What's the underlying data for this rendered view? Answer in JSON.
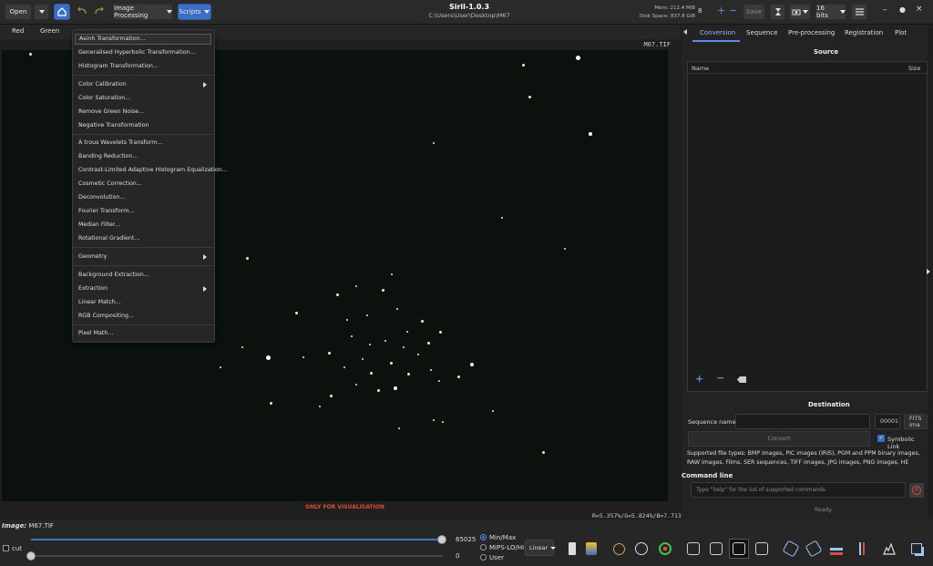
{
  "header": {
    "open_label": "Open",
    "image_processing_label": "Image Processing",
    "scripts_label": "Scripts",
    "app_title": "Siril-1.0.3",
    "file_path": "C:\\Users\\User\\Desktop\\M67",
    "mem": "Mem: 212.4 MiB",
    "disk": "Disk Space: 837.8 GiB",
    "thread_count": "8",
    "save_label": "Save",
    "bits_label": "16 bits"
  },
  "channel_tabs": [
    "Red",
    "Green"
  ],
  "image": {
    "filename": "M67.TIF",
    "only_vis": "ONLY FOR VISUALISATION",
    "rgb_readout": "R=5.357%/G=5.824%/B=7.713%"
  },
  "menu": {
    "items": [
      "Asinh Transformation...",
      "Generalised Hyperbolic Transformation...",
      "Histogram Transformation...",
      "Color Calibration",
      "Color Saturation...",
      "Remove Green Noise...",
      "Negative Transformation",
      "À trous Wavelets Transform...",
      "Banding Reduction...",
      "Contrast-Limited Adaptive Histogram Equalization...",
      "Cosmetic Correction...",
      "Deconvolution...",
      "Fourier Transform...",
      "Median Filter...",
      "Rotational Gradient...",
      "Geometry",
      "Background Extraction...",
      "Extraction",
      "Linear Match...",
      "RGB Compositing...",
      "Pixel Math..."
    ]
  },
  "right_panel": {
    "tabs": [
      "Conversion",
      "Sequence",
      "Pre-processing",
      "Registration",
      "Plot"
    ],
    "source_title": "Source",
    "col_name": "Name",
    "col_size": "Size",
    "destination_title": "Destination",
    "seq_name_label": "Sequence name:",
    "seq_number": "00001",
    "format": "FITS ima",
    "convert_label": "Convert",
    "symbolic_link": "Symbolic Link",
    "file_types_label": "Supported file types:",
    "file_types": "BMP images, PIC images (IRIS), PGM and PPM binary images, RAW images, Films, SER sequences, TIFF images, JPG images, PNG images, HE",
    "command_line_title": "Command line",
    "command_placeholder": "Type \"help\" for the list of supported commands",
    "ready": "Ready."
  },
  "bottom": {
    "image_label": "Image:",
    "image_name": "M67.TIF",
    "cut_label": "cut",
    "max_value": "65025",
    "min_value": "0",
    "range_modes": [
      "Min/Max",
      "MIPS-LO/HI",
      "User"
    ],
    "display_mode": "Linear"
  },
  "colors": {
    "accent": "#3a6fc4",
    "warning": "#e0493f",
    "sky": "#0b120e"
  }
}
